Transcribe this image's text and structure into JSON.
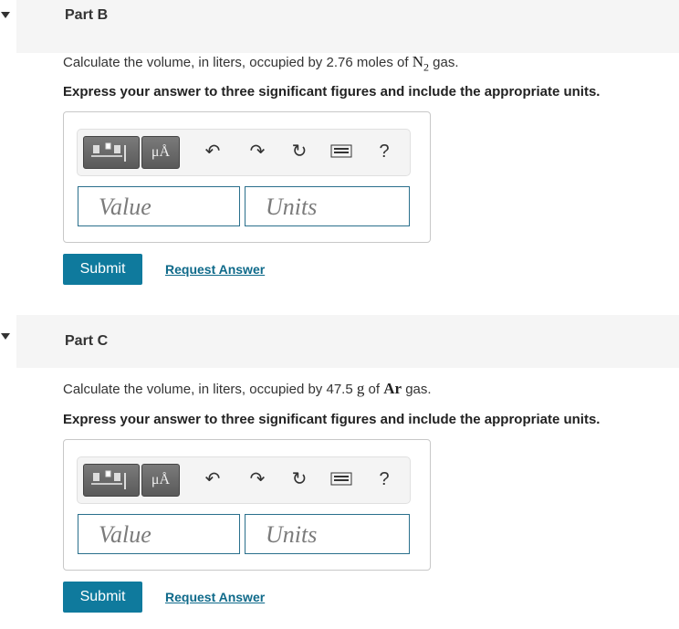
{
  "partB": {
    "title": "Part B",
    "question_pre": "Calculate the volume, in liters, occupied by 2.76 moles of ",
    "formula_main": "N",
    "formula_sub": "2",
    "question_post": " gas.",
    "instruction": "Express your answer to three significant figures and include the appropriate units.",
    "units_button": "μÅ",
    "undo_icon": "undo-icon",
    "redo_icon": "redo-icon",
    "reset_icon": "reset-icon",
    "keyboard_icon": "keyboard-icon",
    "help_label": "?",
    "value_placeholder": "Value",
    "units_placeholder": "Units",
    "submit": "Submit",
    "request": "Request Answer"
  },
  "partC": {
    "title": "Part C",
    "question_pre": "Calculate the volume, in liters, occupied by 47.5 ",
    "unit_g": "g",
    "mid": " of ",
    "formula_main": "Ar",
    "question_post": " gas.",
    "instruction": "Express your answer to three significant figures and include the appropriate units.",
    "units_button": "μÅ",
    "help_label": "?",
    "value_placeholder": "Value",
    "units_placeholder": "Units",
    "submit": "Submit",
    "request": "Request Answer"
  },
  "colors": {
    "accent": "#0f7a9d",
    "link": "#0f6a8a",
    "input_border": "#2a6f8c"
  }
}
